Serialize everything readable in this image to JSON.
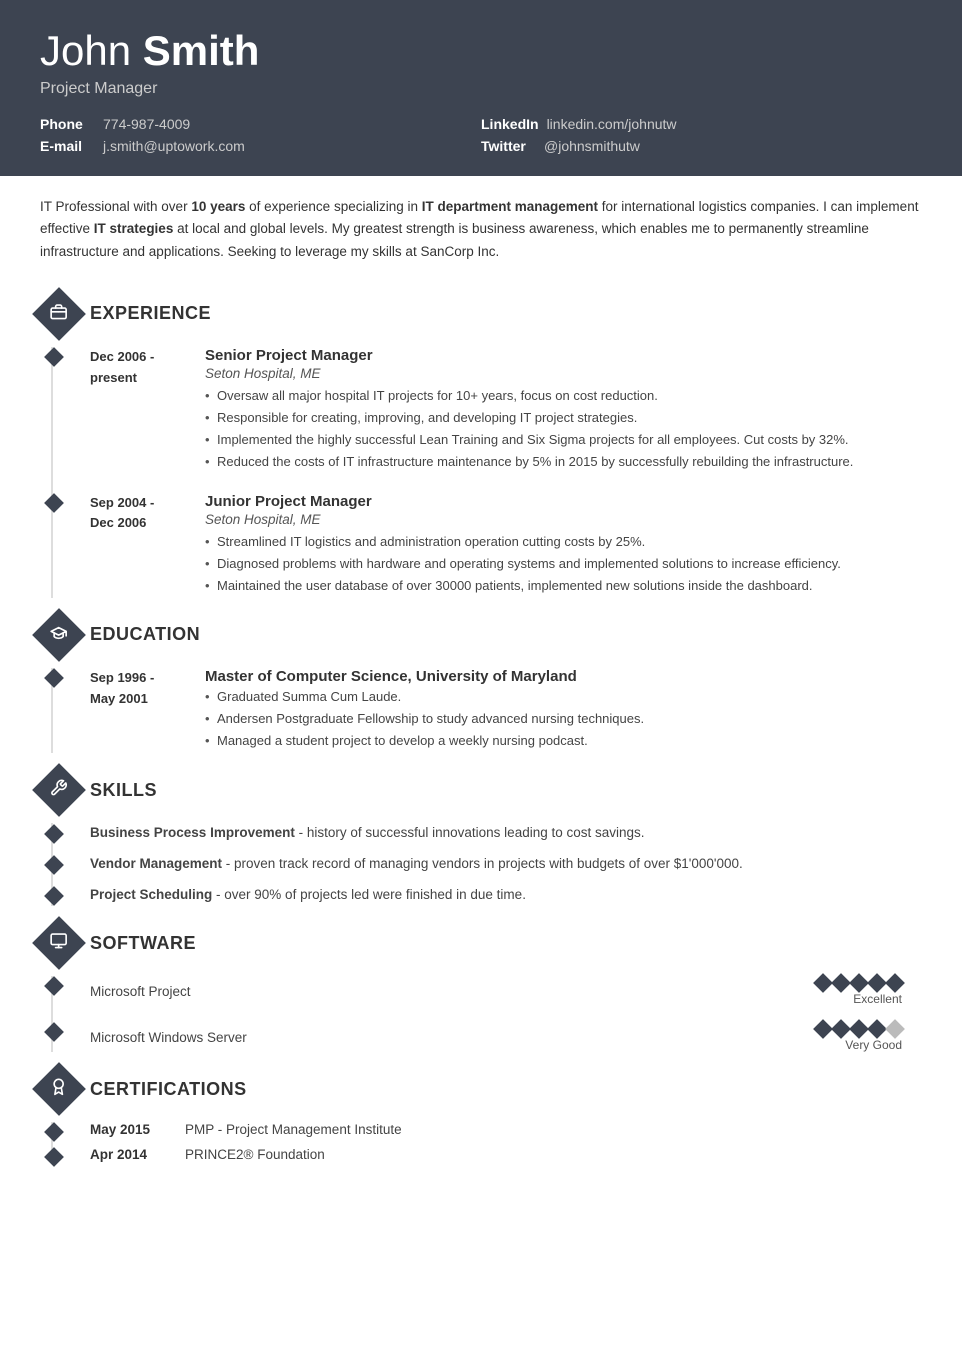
{
  "header": {
    "first_name": "John",
    "last_name": "Smith",
    "title": "Project Manager",
    "phone_label": "Phone",
    "phone_value": "774-987-4009",
    "email_label": "E-mail",
    "email_value": "j.smith@uptowork.com",
    "linkedin_label": "LinkedIn",
    "linkedin_value": "linkedin.com/johnutw",
    "twitter_label": "Twitter",
    "twitter_value": "@johnsmithutw"
  },
  "summary": "IT Professional with over 10 years of experience specializing in IT department management for international logistics companies. I can implement effective IT strategies at local and global levels. My greatest strength is business awareness, which enables me to permanently streamline infrastructure and applications. Seeking to leverage my skills at SanCorp Inc.",
  "summary_bold1": "10 years",
  "summary_bold2": "IT department management",
  "summary_bold3": "IT strategies",
  "sections": {
    "experience": {
      "title": "EXPERIENCE",
      "jobs": [
        {
          "date": "Dec 2006 -\npresent",
          "job_title": "Senior Project Manager",
          "company": "Seton Hospital, ME",
          "bullets": [
            "Oversaw all major hospital IT projects for 10+ years, focus on cost reduction.",
            "Responsible for creating, improving, and developing IT project strategies.",
            "Implemented the highly successful Lean Training and Six Sigma projects for all employees. Cut costs by 32%.",
            "Reduced the costs of IT infrastructure maintenance by 5% in 2015 by successfully rebuilding the infrastructure."
          ]
        },
        {
          "date": "Sep 2004 -\nDec 2006",
          "job_title": "Junior Project Manager",
          "company": "Seton Hospital, ME",
          "bullets": [
            "Streamlined IT logistics and administration operation cutting costs by 25%.",
            "Diagnosed problems with hardware and operating systems and implemented solutions to increase efficiency.",
            "Maintained the user database of over 30000 patients, implemented new solutions inside the dashboard."
          ]
        }
      ]
    },
    "education": {
      "title": "EDUCATION",
      "entries": [
        {
          "date": "Sep 1996 -\nMay 2001",
          "degree": "Master of Computer Science, University of Maryland",
          "bullets": [
            "Graduated Summa Cum Laude.",
            "Andersen Postgraduate Fellowship to study advanced nursing techniques.",
            "Managed a student project to develop a weekly nursing podcast."
          ]
        }
      ]
    },
    "skills": {
      "title": "SKILLS",
      "items": [
        {
          "name": "Business Process Improvement",
          "description": " - history of successful innovations leading to cost savings."
        },
        {
          "name": "Vendor Management",
          "description": " - proven track record of managing vendors in projects with budgets of over $1'000'000."
        },
        {
          "name": "Project Scheduling",
          "description": " - over 90% of projects led were finished in due time."
        }
      ]
    },
    "software": {
      "title": "SOFTWARE",
      "items": [
        {
          "name": "Microsoft Project",
          "rating": 5,
          "total": 5,
          "label": "Excellent"
        },
        {
          "name": "Microsoft Windows Server",
          "rating": 4,
          "total": 5,
          "label": "Very Good"
        }
      ]
    },
    "certifications": {
      "title": "CERTIFICATIONS",
      "items": [
        {
          "date": "May 2015",
          "name": "PMP - Project Management Institute"
        },
        {
          "date": "Apr 2014",
          "name": "PRINCE2® Foundation"
        }
      ]
    }
  }
}
